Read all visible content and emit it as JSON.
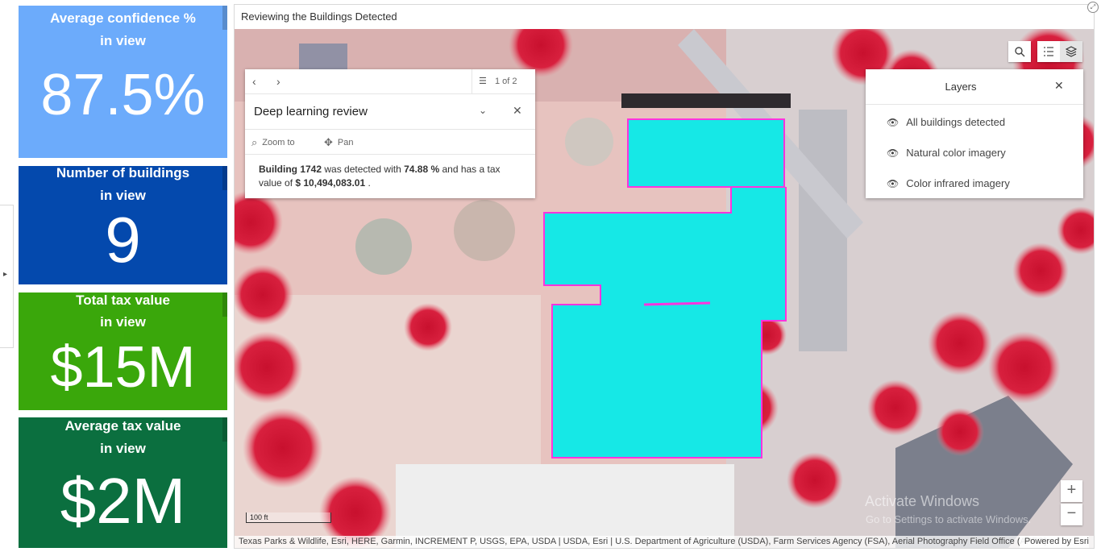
{
  "sidebar": {
    "toggle_glyph": "▸"
  },
  "cards": [
    {
      "label_line1": "Average confidence %",
      "label_line2": "in view",
      "value": "87.5%",
      "color": "#6cabfb"
    },
    {
      "label_line1": "Number of buildings",
      "label_line2": "in view",
      "value": "9",
      "color": "#0449ad"
    },
    {
      "label_line1": "Total tax value",
      "label_line2": "in view",
      "value": "$15M",
      "color": "#3aa70b"
    },
    {
      "label_line1": "Average tax value",
      "label_line2": "in view",
      "value": "$2M",
      "color": "#0b6f3f"
    }
  ],
  "map_panel": {
    "title": "Reviewing the Buildings Detected"
  },
  "popup": {
    "count": "1 of 2",
    "title": "Deep learning review",
    "zoom_label": "Zoom to",
    "pan_label": "Pan",
    "text_part1": "Building 1742",
    "text_part2": " was detected with ",
    "text_part3": "74.88  %",
    "text_part4": " and has a tax value of ",
    "text_part5": "$ 10,494,083.01",
    "text_part6": " ."
  },
  "layers": {
    "title": "Layers",
    "items": [
      "All buildings detected",
      "Natural color imagery",
      "Color infrared imagery"
    ]
  },
  "scale_label": "100 ft",
  "attribution": "Texas Parks & Wildlife, Esri, HERE, Garmin, INCREMENT P, USGS, EPA, USDA | USDA, Esri | U.S. Department of Agriculture (USDA), Farm Services Agency (FSA), Aerial Photography Field Office (APFO)...",
  "powered_by": "Powered by Esri",
  "watermark": {
    "line1": "Activate Windows",
    "line2": "Go to Settings to activate Windows."
  },
  "zoom": {
    "in": "+",
    "out": "−"
  }
}
